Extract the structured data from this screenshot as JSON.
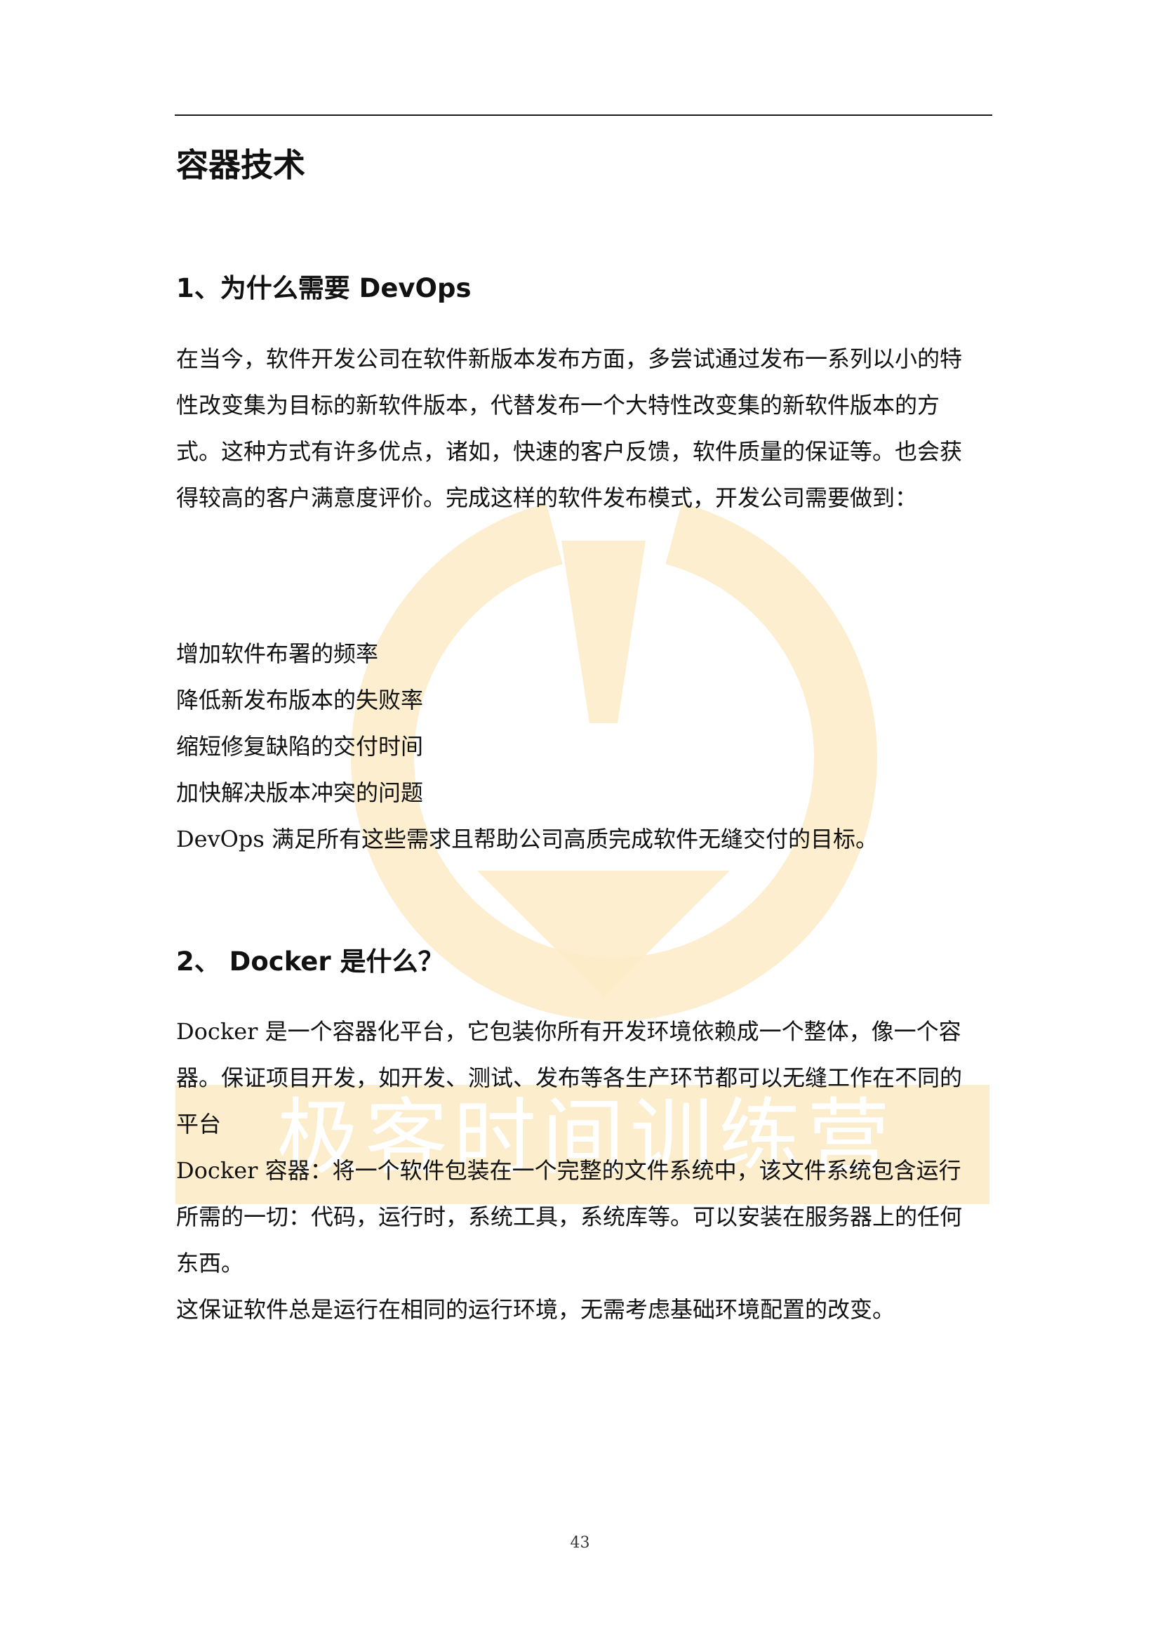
{
  "title": "容器技术",
  "section1": {
    "heading": "1、为什么需要 DevOps",
    "paragraph": "在当今，软件开发公司在软件新版本发布方面，多尝试通过发布一系列以小的特性改变集为目标的新软件版本，代替发布一个大特性改变集的新软件版本的方式。这种方式有许多优点，诸如，快速的客户反馈，软件质量的保证等。也会获得较高的客户满意度评价。完成这样的软件发布模式，开发公司需要做到：",
    "items": [
      "增加软件布署的频率",
      "降低新发布版本的失败率",
      "缩短修复缺陷的交付时间",
      "加快解决版本冲突的问题"
    ],
    "conclusion": "DevOps 满足所有这些需求且帮助公司高质完成软件无缝交付的目标。"
  },
  "section2": {
    "heading": "2、 Docker 是什么？",
    "paragraph1": "Docker 是一个容器化平台，它包装你所有开发环境依赖成一个整体，像一个容器。保证项目开发，如开发、测试、发布等各生产环节都可以无缝工作在不同的平台",
    "paragraph2": "Docker 容器：将一个软件包装在一个完整的文件系统中，该文件系统包含运行所需的一切：代码，运行时，系统工具，系统库等。可以安装在服务器上的任何东西。",
    "paragraph3": "这保证软件总是运行在相同的运行环境，无需考虑基础环境配置的改变。"
  },
  "watermark": {
    "text": "极客时间训练营",
    "color": "#fbe6b8"
  },
  "page_number": "43"
}
